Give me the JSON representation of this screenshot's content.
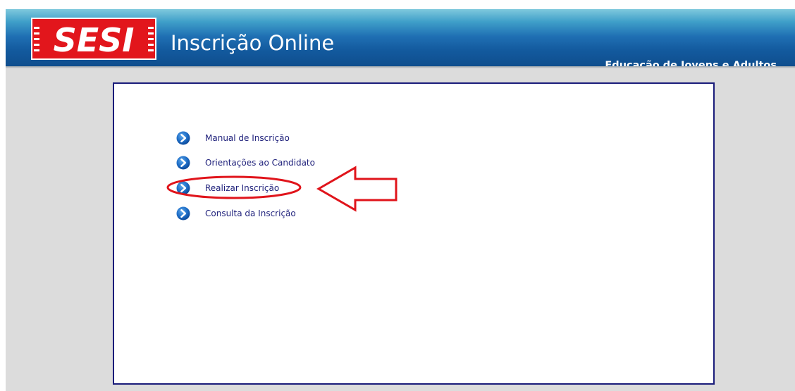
{
  "header": {
    "logo_text": "SESI",
    "title": "Inscrição Online",
    "subtitle": "Educação de Jovens e Adultos"
  },
  "menu": {
    "items": [
      {
        "label": "Manual de Inscrição",
        "icon": "chevron-right-circle-icon"
      },
      {
        "label": "Orientações ao Candidato",
        "icon": "chevron-right-circle-icon"
      },
      {
        "label": "Realizar Inscrição",
        "icon": "chevron-right-circle-icon",
        "highlighted": true
      },
      {
        "label": "Consulta da Inscrição",
        "icon": "chevron-right-circle-icon"
      }
    ]
  },
  "annotation": {
    "highlight_color": "#e0141b",
    "arrow": "left-pointing-arrow"
  },
  "colors": {
    "header_blue": "#135a9e",
    "panel_border": "#1a1c7a",
    "link_text": "#1d1f7a",
    "background": "#dcdcdc",
    "logo_red": "#e2161c"
  }
}
